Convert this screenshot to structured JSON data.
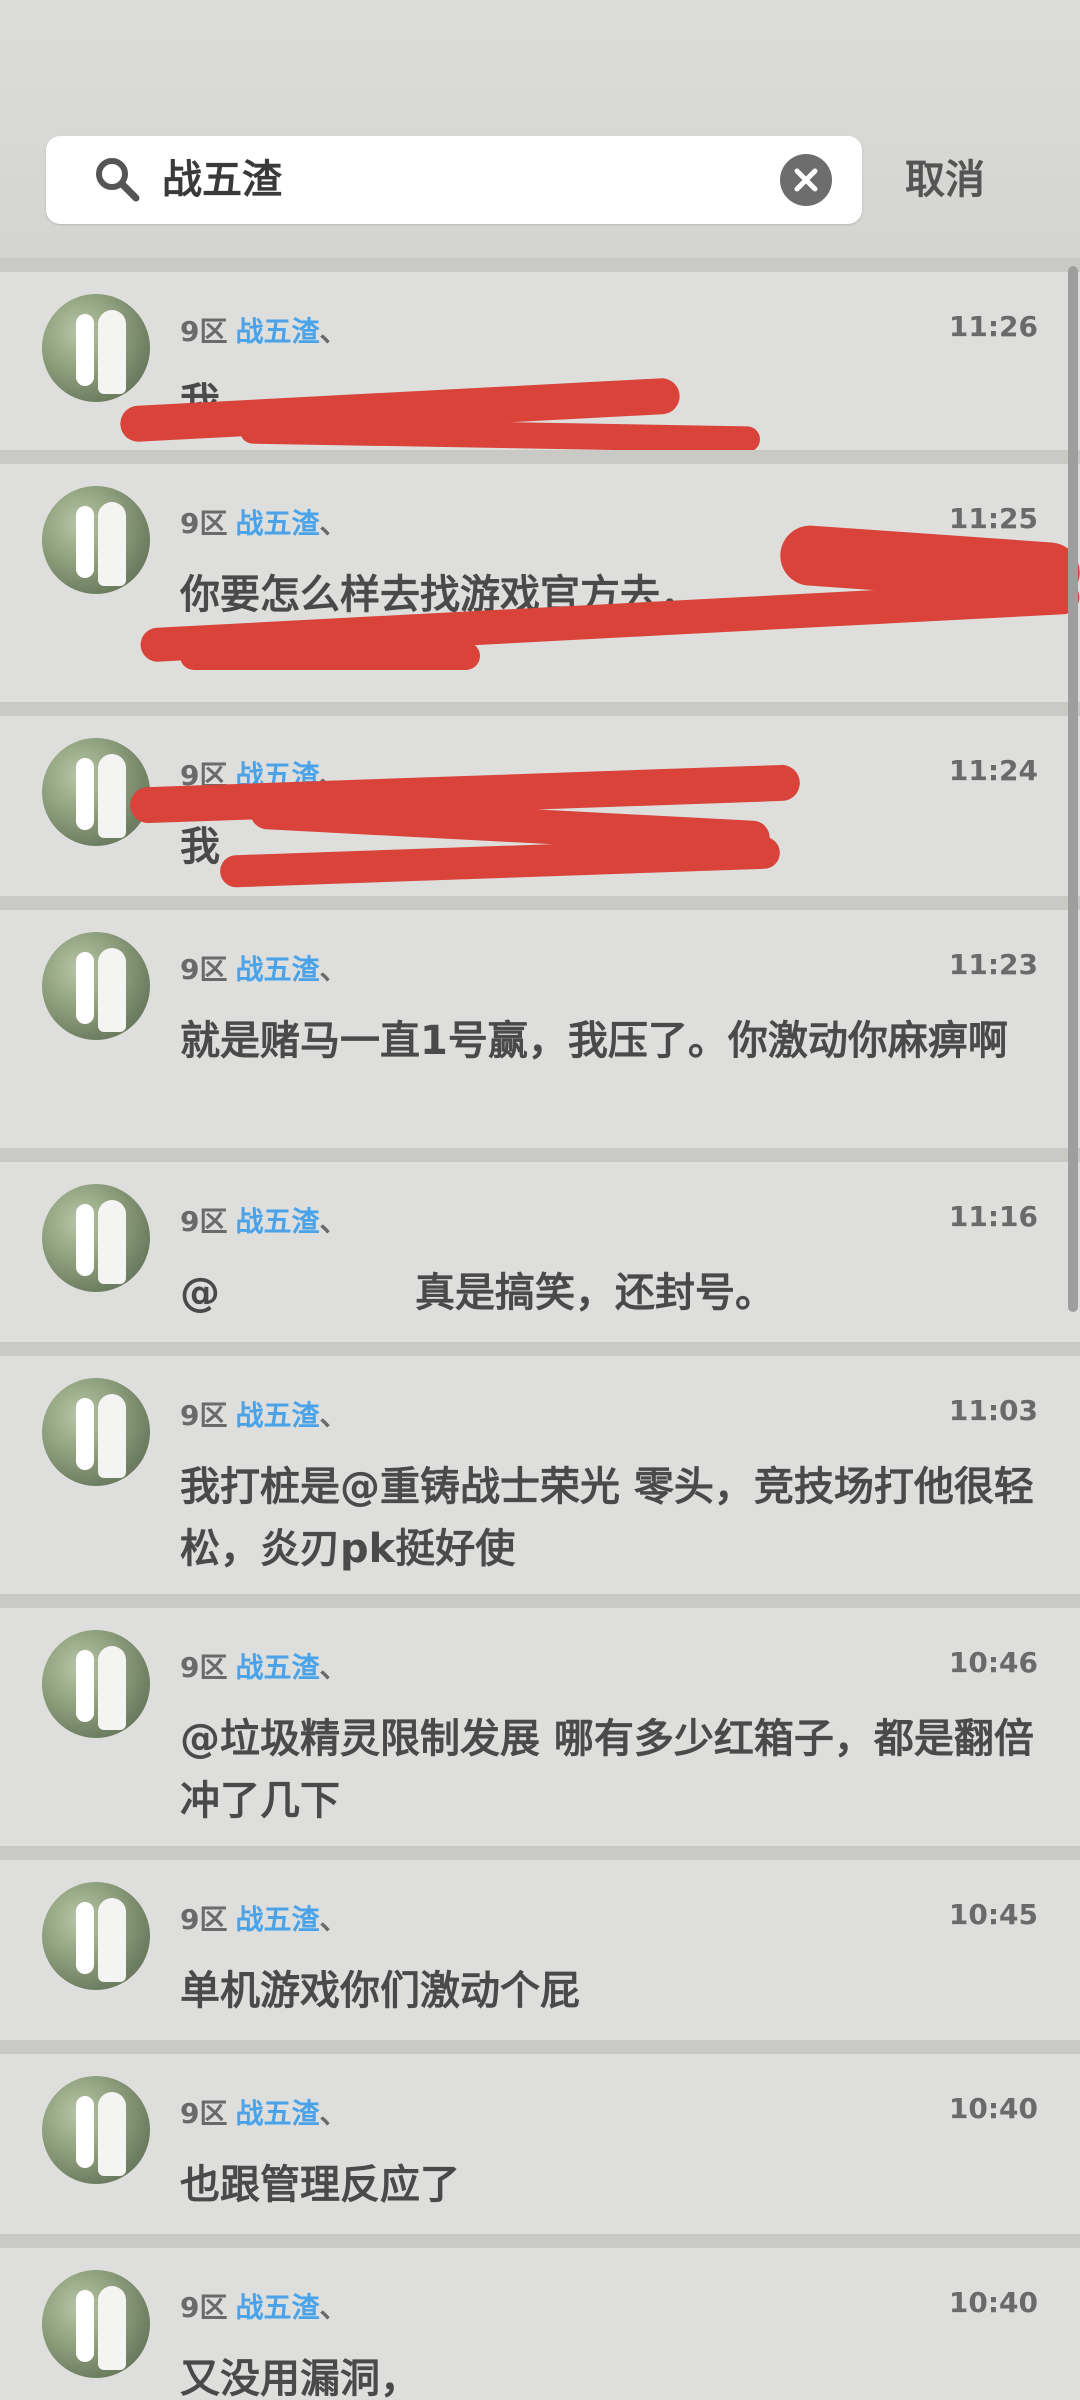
{
  "search": {
    "query": "战五渣",
    "cancel_label": "取消"
  },
  "messages": [
    {
      "region": "9区",
      "name": "战五渣",
      "sep": "、",
      "time": "11:26",
      "text": "我",
      "redacted": true
    },
    {
      "region": "9区",
      "name": "战五渣",
      "sep": "、",
      "time": "11:25",
      "text": "你要怎么样去找游戏官方去，",
      "redacted": true
    },
    {
      "region": "9区",
      "name": "战五渣",
      "sep": "、",
      "time": "11:24",
      "text": "我",
      "redacted": true
    },
    {
      "region": "9区",
      "name": "战五渣",
      "sep": "、",
      "time": "11:23",
      "text": "就是赌马一直1号赢，我压了。你激动你麻痹啊",
      "redacted": false
    },
    {
      "region": "9区",
      "name": "战五渣",
      "sep": "、",
      "time": "11:16",
      "text": "@              真是搞笑，还封号。",
      "redacted": false
    },
    {
      "region": "9区",
      "name": "战五渣",
      "sep": "、",
      "time": "11:03",
      "text": "我打桩是@重铸战士荣光 零头，竞技场打他很轻松，炎刃pk挺好使",
      "redacted": false
    },
    {
      "region": "9区",
      "name": "战五渣",
      "sep": "、",
      "time": "10:46",
      "text": "@垃圾精灵限制发展  哪有多少红箱子，都是翻倍冲了几下",
      "redacted": false
    },
    {
      "region": "9区",
      "name": "战五渣",
      "sep": "、",
      "time": "10:45",
      "text": "单机游戏你们激动个屁",
      "redacted": false
    },
    {
      "region": "9区",
      "name": "战五渣",
      "sep": "、",
      "time": "10:40",
      "text": "也跟管理反应了",
      "redacted": false
    },
    {
      "region": "9区",
      "name": "战五渣",
      "sep": "、",
      "time": "10:40",
      "text": "又没用漏洞，",
      "redacted": false
    }
  ]
}
